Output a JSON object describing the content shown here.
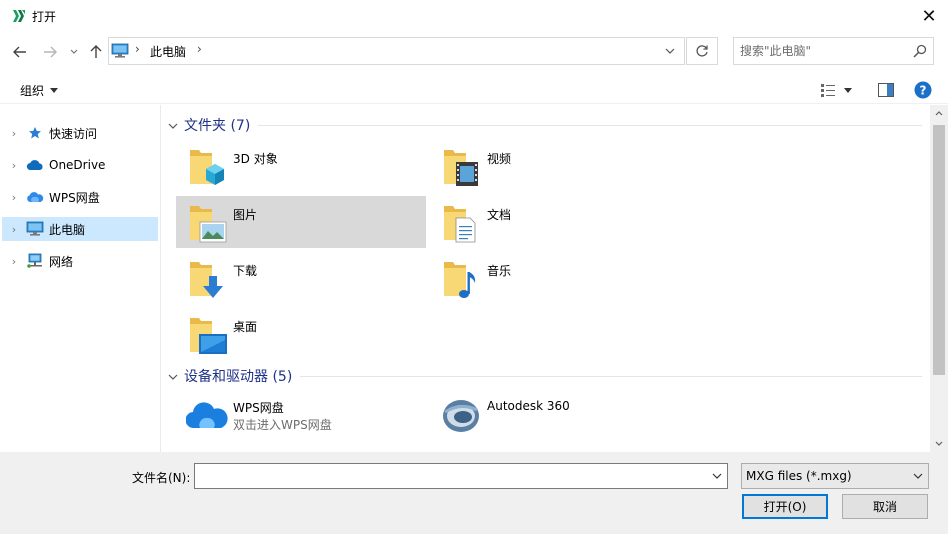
{
  "window": {
    "title": "打开",
    "close_glyph": "✕"
  },
  "nav": {
    "address_location": "此电脑",
    "search_placeholder": "搜索\"此电脑\""
  },
  "toolbar": {
    "organize_label": "组织",
    "help_glyph": "?"
  },
  "sidebar": {
    "items": [
      {
        "label": "快速访问",
        "icon": "star-icon"
      },
      {
        "label": "OneDrive",
        "icon": "cloud-icon"
      },
      {
        "label": "WPS网盘",
        "icon": "wps-cloud-icon"
      },
      {
        "label": "此电脑",
        "icon": "computer-icon",
        "selected": true
      },
      {
        "label": "网络",
        "icon": "network-icon"
      }
    ]
  },
  "groups": {
    "folders": {
      "header": "文件夹 (7)",
      "items": [
        {
          "label": "3D 对象",
          "icon": "folder-3d-icon"
        },
        {
          "label": "视频",
          "icon": "folder-video-icon"
        },
        {
          "label": "图片",
          "icon": "folder-pictures-icon",
          "selected": true
        },
        {
          "label": "文档",
          "icon": "folder-documents-icon"
        },
        {
          "label": "下载",
          "icon": "folder-downloads-icon"
        },
        {
          "label": "音乐",
          "icon": "folder-music-icon"
        },
        {
          "label": "桌面",
          "icon": "folder-desktop-icon"
        }
      ]
    },
    "drives": {
      "header": "设备和驱动器 (5)",
      "items": [
        {
          "label": "WPS网盘",
          "sub": "双击进入WPS网盘",
          "icon": "wps-cloud-drive-icon"
        },
        {
          "label": "Autodesk 360",
          "icon": "autodesk-360-icon"
        }
      ]
    }
  },
  "bottom": {
    "filename_label": "文件名(N):",
    "filename_value": "",
    "filetype_value": "MXG files (*.mxg)",
    "open_label": "打开(O)",
    "cancel_label": "取消"
  },
  "colors": {
    "accent": "#0078d7",
    "group_header": "#1e3287",
    "selection": "#cce8ff",
    "tile_selection": "#d9d9d9"
  }
}
